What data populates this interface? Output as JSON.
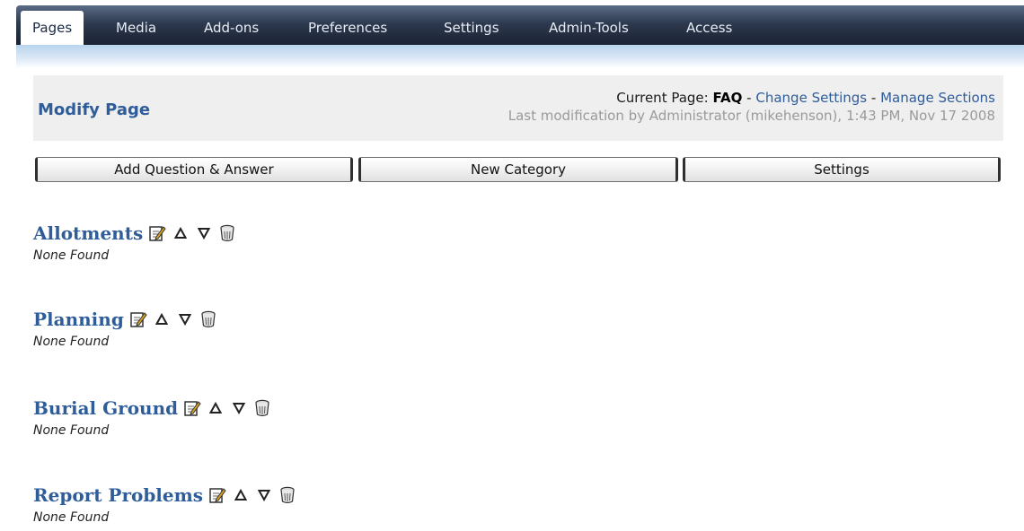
{
  "nav": {
    "items": [
      {
        "label": "Pages",
        "active": true
      },
      {
        "label": "Media"
      },
      {
        "label": "Add-ons"
      },
      {
        "label": "Preferences"
      },
      {
        "label": "Settings"
      },
      {
        "label": "Admin-Tools"
      },
      {
        "label": "Access"
      }
    ]
  },
  "header": {
    "title": "Modify Page",
    "current_page_prefix": "Current Page:",
    "current_page": "FAQ",
    "sep1": "-",
    "change_settings": "Change Settings",
    "sep2": "-",
    "manage_sections": "Manage Sections",
    "last_modification": "Last modification by Administrator (mikehenson), 1:43 PM, Nov 17 2008"
  },
  "buttons": {
    "add_qa": "Add Question & Answer",
    "new_category": "New Category",
    "settings": "Settings"
  },
  "categories": [
    {
      "name": "Allotments",
      "status": "None Found"
    },
    {
      "name": "Planning",
      "status": "None Found"
    },
    {
      "name": "Burial Ground",
      "status": "None Found"
    },
    {
      "name": "Report Problems",
      "status": "None Found"
    }
  ],
  "colors": {
    "link": "#2f5d9a",
    "nav_bg": "#2e3a4f",
    "header_bg": "#efefef"
  },
  "icons": [
    "edit-icon",
    "move-up-icon",
    "move-down-icon",
    "delete-icon"
  ]
}
